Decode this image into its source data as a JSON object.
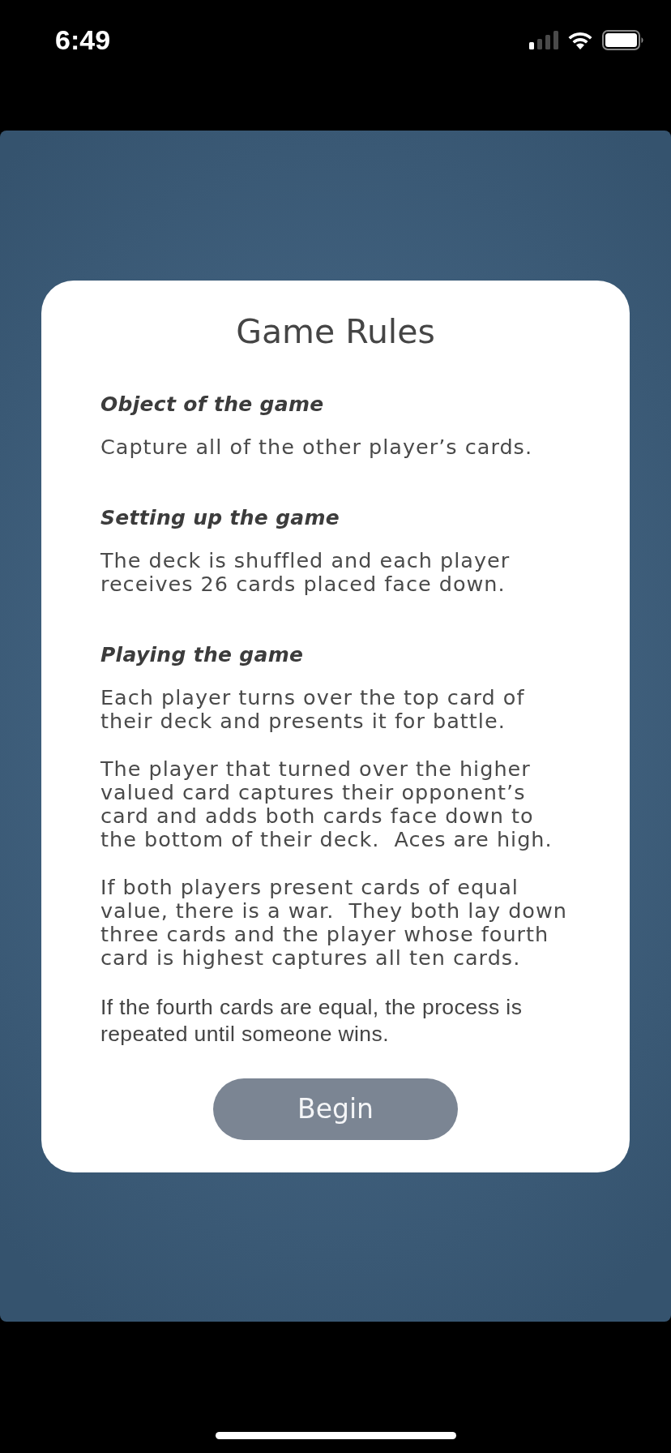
{
  "status_bar": {
    "time": "6:49"
  },
  "dialog": {
    "title": "Game Rules",
    "sections": [
      {
        "heading": "Object of the game",
        "paragraphs": [
          {
            "kind": "styled",
            "text": "Capture all of the other player’s cards."
          }
        ]
      },
      {
        "heading": "Setting up the game",
        "paragraphs": [
          {
            "kind": "styled",
            "text": "The deck is shuffled and each player receives 26 cards placed face down."
          }
        ]
      },
      {
        "heading": "Playing the game",
        "paragraphs": [
          {
            "kind": "styled",
            "text": "Each player turns over the top card of their deck and presents it for battle."
          },
          {
            "kind": "styled",
            "text": "The player that turned over the higher valued card captures their opponent’s card and adds both cards face down to the bottom of their deck.  Aces are high."
          },
          {
            "kind": "styled",
            "text": "If both players present cards of equal value, there is a war.  They both lay down three cards and the player whose fourth card is highest captures all ten cards."
          },
          {
            "kind": "system",
            "text": "If the fourth cards are equal, the process is repeated until someone wins."
          }
        ]
      }
    ],
    "button": {
      "label": "Begin"
    }
  }
}
